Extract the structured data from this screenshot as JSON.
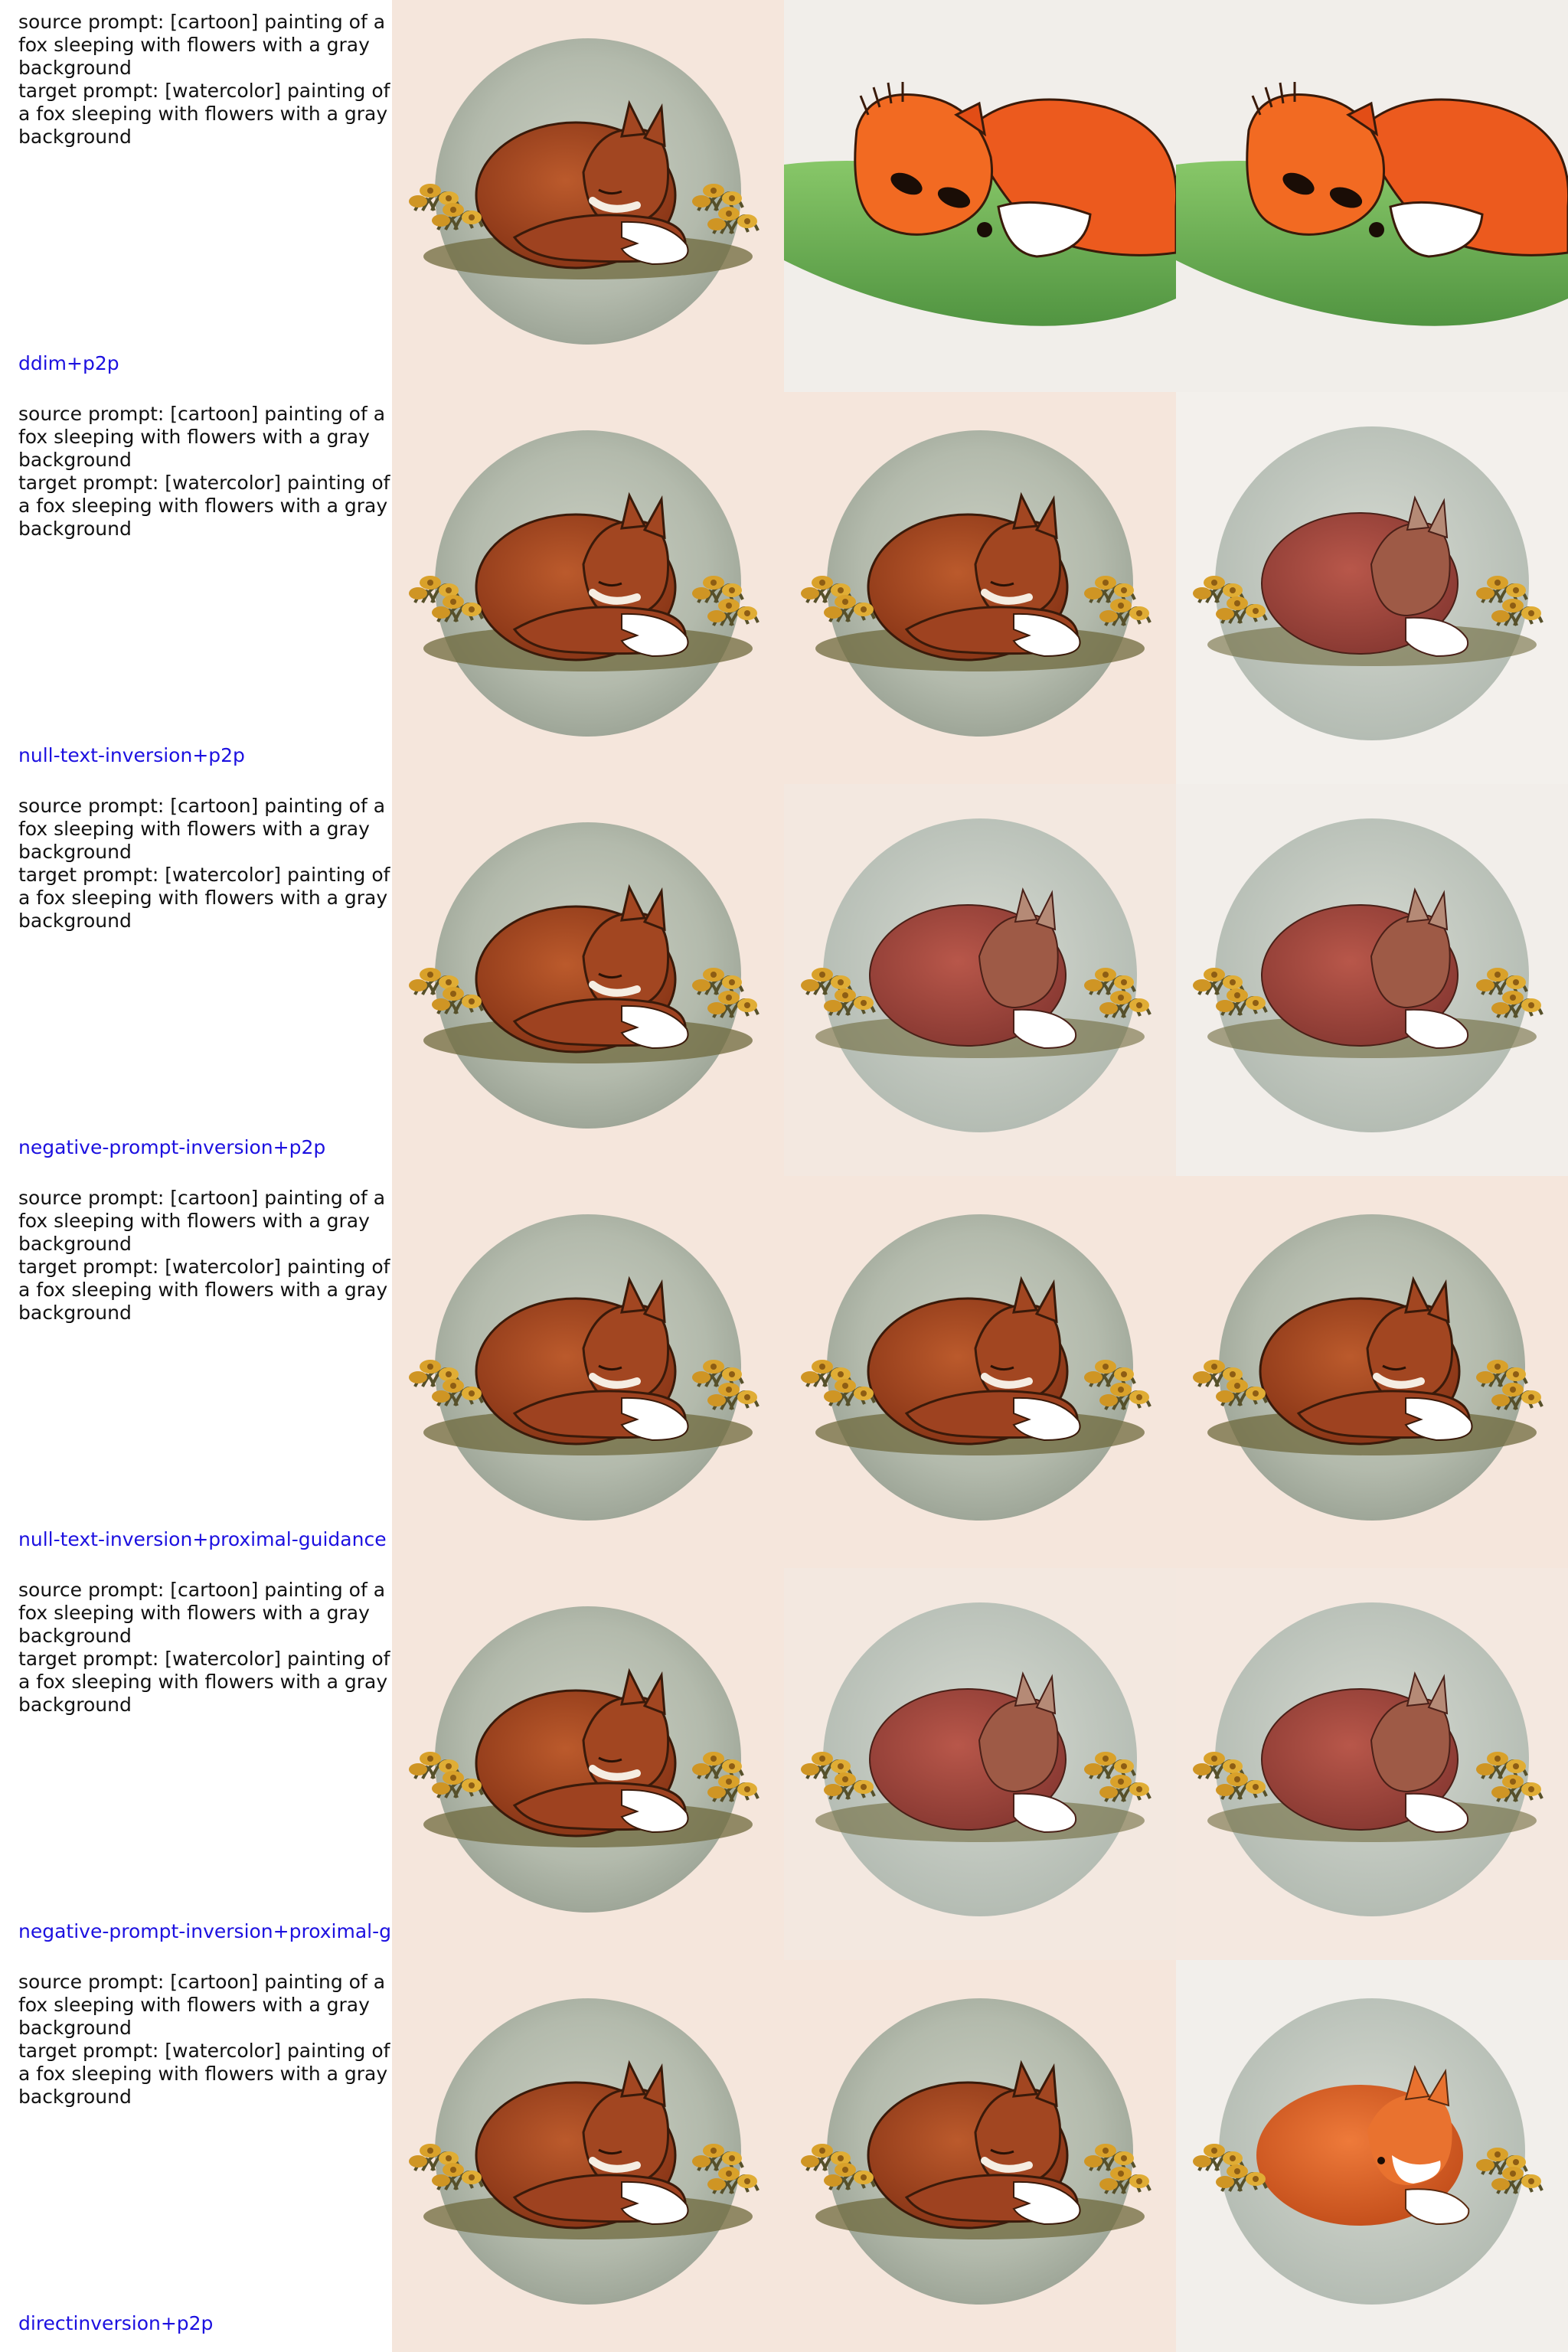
{
  "rows": [
    {
      "prompt": "source prompt: [cartoon] painting of a\nfox sleeping with flowers with a gray\nbackground\ntarget prompt: [watercolor] painting of\na fox sleeping with flowers with a gray\nbackground",
      "method": "ddim+p2p",
      "images": [
        "source-fox-cartoon",
        "edited-fox-bright-grass",
        "edited-fox-bright-grass"
      ]
    },
    {
      "prompt": "source prompt: [cartoon] painting of a\nfox sleeping with flowers with a gray\nbackground\ntarget prompt: [watercolor] painting of\na fox sleeping with flowers with a gray\nbackground",
      "method": "null-text-inversion+p2p",
      "images": [
        "source-fox-cartoon",
        "reconstructed-fox-cartoon",
        "edited-fox-watercolor"
      ]
    },
    {
      "prompt": "source prompt: [cartoon] painting of a\nfox sleeping with flowers with a gray\nbackground\ntarget prompt: [watercolor] painting of\na fox sleeping with flowers with a gray\nbackground",
      "method": "negative-prompt-inversion+p2p",
      "images": [
        "source-fox-cartoon",
        "reconstructed-fox-soft",
        "edited-fox-watercolor-dark"
      ]
    },
    {
      "prompt": "source prompt: [cartoon] painting of a\nfox sleeping with flowers with a gray\nbackground\ntarget prompt: [watercolor] painting of\na fox sleeping with flowers with a gray\nbackground",
      "method": "null-text-inversion+proximal-guidance",
      "images": [
        "source-fox-cartoon",
        "reconstructed-fox-cartoon",
        "edited-fox-cartoon"
      ]
    },
    {
      "prompt": "source prompt: [cartoon] painting of a\nfox sleeping with flowers with a gray\nbackground\ntarget prompt: [watercolor] painting of\na fox sleeping with flowers with a gray\nbackground",
      "method": "negative-prompt-inversion+proximal-g",
      "images": [
        "source-fox-cartoon",
        "reconstructed-fox-soft",
        "edited-fox-watercolor"
      ]
    },
    {
      "prompt": "source prompt: [cartoon] painting of a\nfox sleeping with flowers with a gray\nbackground\ntarget prompt: [watercolor] painting of\na fox sleeping with flowers with a gray\nbackground",
      "method": "directinversion+p2p",
      "images": [
        "source-fox-cartoon",
        "reconstructed-fox-cartoon",
        "edited-fox-orange-watercolor"
      ]
    }
  ],
  "colors": {
    "prompt_text": "#111111",
    "method_text": "#1c10e0",
    "paper": "#f5e6dc",
    "paper_white": "#f3f0ec",
    "circle_gray": "#b9c0b2",
    "fox_brown": "#a5491f",
    "fox_orange": "#e8501c",
    "flower_yellow": "#d9a12a",
    "grass_green": "#58a840"
  }
}
